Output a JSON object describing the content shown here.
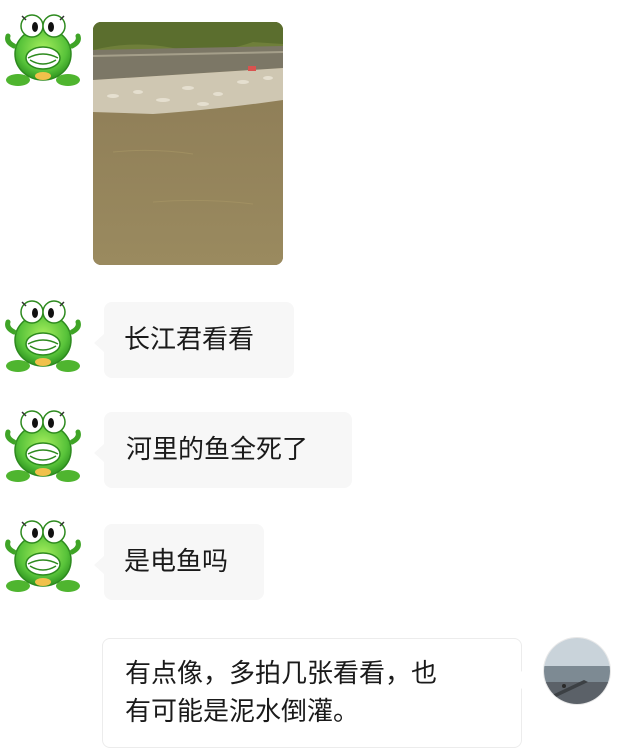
{
  "chat": {
    "messages": [
      {
        "sender": "other",
        "kind": "image",
        "image_desc": "river bank with dead fish"
      },
      {
        "sender": "other",
        "kind": "text",
        "text": "长江君看看"
      },
      {
        "sender": "other",
        "kind": "text",
        "text": "河里的鱼全死了"
      },
      {
        "sender": "other",
        "kind": "text",
        "text": "是电鱼吗"
      },
      {
        "sender": "self",
        "kind": "text",
        "lines": [
          "有点像，多拍几张看看，也",
          "有可能是泥水倒灌。"
        ]
      }
    ],
    "avatars": {
      "other": "green-frog-avatar-icon",
      "self": "seascape-avatar-icon"
    }
  },
  "colors": {
    "background": "#ffffff",
    "bubble_other": "#f7f7f7",
    "bubble_self": "#ffffff",
    "text": "#1a1a1a",
    "frog_green": "#55c234"
  }
}
